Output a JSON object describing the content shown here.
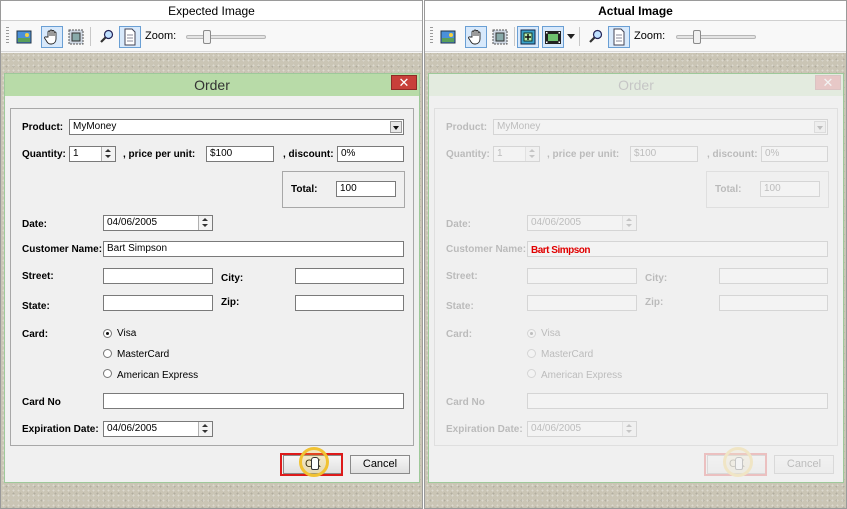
{
  "left_pane": {
    "title": "Expected Image"
  },
  "right_pane": {
    "title": "Actual Image"
  },
  "toolbar": {
    "zoom_label": "Zoom:"
  },
  "form": {
    "title": "Order",
    "close_glyph": "✕",
    "product_label": "Product:",
    "product_value": "MyMoney",
    "quantity_label": "Quantity:",
    "quantity_value": "1",
    "price_label": ", price per unit:",
    "price_value": "$100",
    "discount_label": ", discount:",
    "discount_value": "0%",
    "total_label": "Total:",
    "total_value": "100",
    "date_label": "Date:",
    "date_value": "04/06/2005",
    "customer_label": "Customer Name:",
    "customer_value": "Bart Simpson",
    "street_label": "Street:",
    "city_label": "City:",
    "state_label": "State:",
    "zip_label": "Zip:",
    "card_label": "Card:",
    "card_options": [
      "Visa",
      "MasterCard",
      "American Express"
    ],
    "card_selected": "Visa",
    "card_no_label": "Card No",
    "expiration_label": "Expiration Date:",
    "expiration_value": "04/06/2005",
    "ok_label": "OK",
    "cancel_label": "Cancel"
  },
  "actual": {
    "customer_value_rendered": "Bart Simpson"
  },
  "colors": {
    "highlight": "#dd1a1a",
    "dialog_title_bar": "#b8dba8",
    "close_button": "#c8403a",
    "pointer_ring": "#f1c232"
  },
  "icons": [
    "image-icon",
    "hand-icon",
    "select-region-icon",
    "zoom-magnifier-icon",
    "page-icon",
    "zoom-in-icon",
    "filmstrip-icon"
  ]
}
